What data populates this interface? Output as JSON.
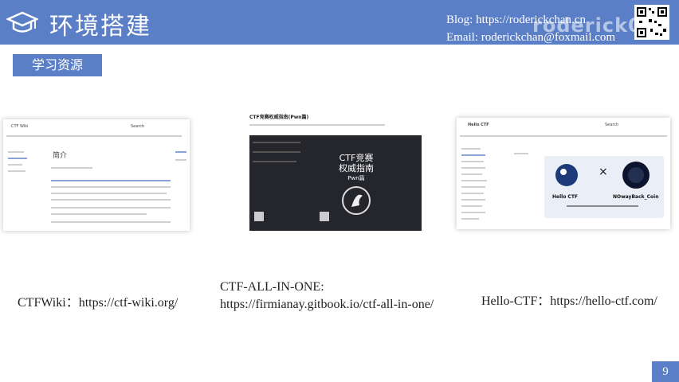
{
  "header": {
    "title": "环境搭建",
    "blog": "Blog: https://roderickchan.cn",
    "email": "Email: roderickchan@foxmail.com",
    "watermark": "roderick01"
  },
  "section_tag": "学习资源",
  "resources": [
    {
      "caption": "CTFWiki：https://ctf-wiki.org/",
      "thumb": {
        "site": "CTF Wiki",
        "heading": "简介",
        "search": "Search"
      }
    },
    {
      "caption_line1": "CTF-ALL-IN-ONE:",
      "caption_line2": "https://firmianay.gitbook.io/ctf-all-in-one/",
      "thumb": {
        "heading": "CTF竞赛权威指南(Pwn篇)",
        "book_title_1": "CTF竞赛",
        "book_title_2": "权威指南",
        "book_sub": "Pwn篇"
      }
    },
    {
      "caption": "Hello-CTF：https://hello-ctf.com/",
      "thumb": {
        "site": "Hello CTF",
        "search": "Search",
        "logo_left": "Hello CTF",
        "logo_x": "×",
        "logo_right": "NOwayBack_Coin"
      }
    }
  ],
  "page_number": "9"
}
